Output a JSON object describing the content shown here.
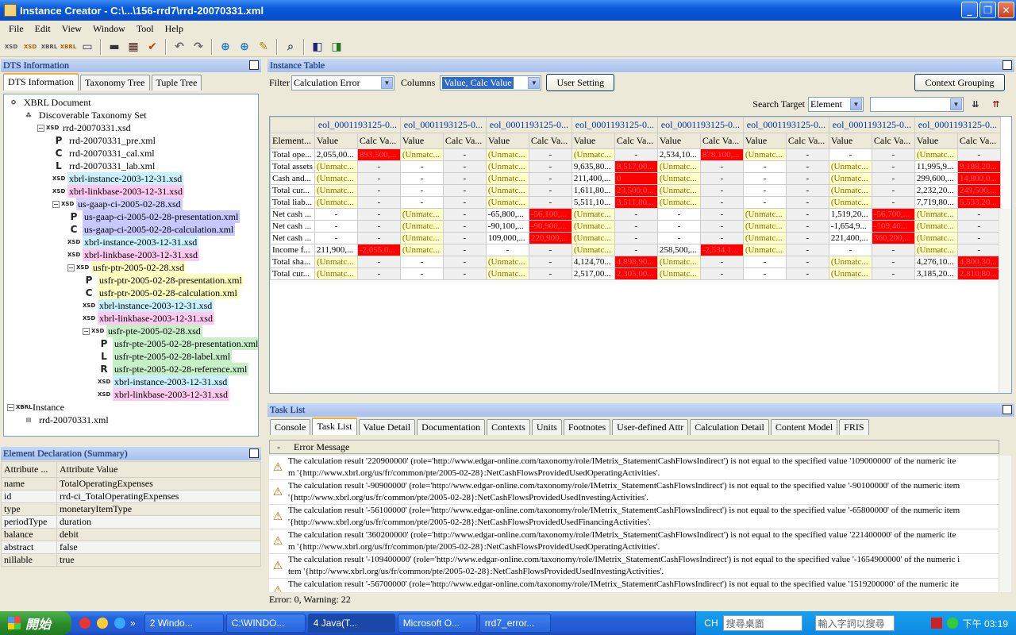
{
  "window": {
    "title": "Instance Creator - C:\\...\\156-rrd7\\rrd-20070331.xml"
  },
  "menu": [
    "File",
    "Edit",
    "View",
    "Window",
    "Tool",
    "Help"
  ],
  "toolbar_icons": [
    "xsd",
    "xsd-new",
    "xbrl",
    "xbrl-new",
    "table",
    "save",
    "print",
    "check",
    "undo",
    "redo",
    "add",
    "add2",
    "edit",
    "find",
    "back",
    "forward"
  ],
  "dts": {
    "title": "DTS Information",
    "tabs": [
      "DTS Information",
      "Taxonomy Tree",
      "Tuple Tree"
    ],
    "tree": [
      {
        "label": "XBRL Document",
        "icon": "root"
      },
      {
        "label": "Discoverable Taxonomy Set",
        "icon": "dts"
      },
      {
        "label": "rrd-20070331.xsd",
        "icon": "xsd"
      },
      {
        "label": "rrd-20070331_pre.xml",
        "icon": "P"
      },
      {
        "label": "rrd-20070331_cal.xml",
        "icon": "C"
      },
      {
        "label": "rrd-20070331_lab.xml",
        "icon": "L"
      },
      {
        "label": "xbrl-instance-2003-12-31.xsd",
        "icon": "xsd",
        "color": "#c8f0ff"
      },
      {
        "label": "xbrl-linkbase-2003-12-31.xsd",
        "icon": "xsd",
        "color": "#ffc8f0"
      },
      {
        "label": "us-gaap-ci-2005-02-28.xsd",
        "icon": "xsd",
        "color": "#d0d0ff"
      },
      {
        "label": "us-gaap-ci-2005-02-28-presentation.xml",
        "icon": "P",
        "color": "#c8c8ff"
      },
      {
        "label": "us-gaap-ci-2005-02-28-calculation.xml",
        "icon": "C",
        "color": "#c8c8ff"
      },
      {
        "label": "xbrl-instance-2003-12-31.xsd",
        "icon": "xsd",
        "color": "#c8f0ff"
      },
      {
        "label": "xbrl-linkbase-2003-12-31.xsd",
        "icon": "xsd",
        "color": "#ffc8f0"
      },
      {
        "label": "usfr-ptr-2005-02-28.xsd",
        "icon": "xsd",
        "color": "#ffffc0"
      },
      {
        "label": "usfr-ptr-2005-02-28-presentation.xml",
        "icon": "P",
        "color": "#ffffc0"
      },
      {
        "label": "usfr-ptr-2005-02-28-calculation.xml",
        "icon": "C",
        "color": "#ffffc0"
      },
      {
        "label": "xbrl-instance-2003-12-31.xsd",
        "icon": "xsd",
        "color": "#c8f0ff"
      },
      {
        "label": "xbrl-linkbase-2003-12-31.xsd",
        "icon": "xsd",
        "color": "#ffc8f0"
      },
      {
        "label": "usfr-pte-2005-02-28.xsd",
        "icon": "xsd",
        "color": "#c8f0c8"
      },
      {
        "label": "usfr-pte-2005-02-28-presentation.xml",
        "icon": "P",
        "color": "#c8f0c8"
      },
      {
        "label": "usfr-pte-2005-02-28-label.xml",
        "icon": "L",
        "color": "#c8f0c8"
      },
      {
        "label": "usfr-pte-2005-02-28-reference.xml",
        "icon": "R",
        "color": "#c8f0c8"
      },
      {
        "label": "xbrl-instance-2003-12-31.xsd",
        "icon": "xsd",
        "color": "#c8f0ff"
      },
      {
        "label": "xbrl-linkbase-2003-12-31.xsd",
        "icon": "xsd",
        "color": "#ffc8f0"
      },
      {
        "label": "Instance",
        "icon": "xbrl"
      },
      {
        "label": "rrd-20070331.xml",
        "icon": "xml"
      }
    ]
  },
  "element_decl": {
    "title": "Element Declaration (Summary)",
    "headers": [
      "Attribute ...",
      "Attribute Value"
    ],
    "rows": [
      [
        "name",
        "TotalOperatingExpenses"
      ],
      [
        "id",
        "rrd-ci_TotalOperatingExpenses"
      ],
      [
        "type",
        "monetaryItemType"
      ],
      [
        "periodType",
        "duration"
      ],
      [
        "balance",
        "debit"
      ],
      [
        "abstract",
        "false"
      ],
      [
        "nillable",
        "true"
      ]
    ]
  },
  "instance_table": {
    "title": "Instance Table",
    "filter_label": "Filter",
    "filter_value": "Calculation Error",
    "columns_label": "Columns",
    "columns_value": "Value, Calc Value",
    "user_setting": "User Setting",
    "context_grouping": "Context Grouping",
    "search_target_label": "Search Target",
    "search_target_value": "Element",
    "context_header": "eol_0001193125-0...",
    "element_header": "Element...",
    "value_header": "Value",
    "calc_header": "Calc Va...",
    "rows": [
      {
        "name": "Total ope...",
        "cells": [
          [
            "2,055,00...",
            "893,500,..."
          ],
          [
            "(Unmatc...",
            "-"
          ],
          [
            "(Unmatc...",
            "-"
          ],
          [
            "(Unmatc...",
            "-"
          ],
          [
            "2,534,10...",
            "878,100,..."
          ],
          [
            "(Unmatc...",
            "-"
          ],
          [
            "-",
            "-"
          ],
          [
            "(Unmatc...",
            "-"
          ]
        ]
      },
      {
        "name": "Total assets",
        "cells": [
          [
            "(Unmatc...",
            "-"
          ],
          [
            "-",
            "-"
          ],
          [
            "(Unmatc...",
            "-"
          ],
          [
            "9,635,80...",
            "8,517,00..."
          ],
          [
            "(Unmatc...",
            "-"
          ],
          [
            "-",
            "-"
          ],
          [
            "(Unmatc...",
            "-"
          ],
          [
            "11,995,9...",
            "9,188,20..."
          ]
        ]
      },
      {
        "name": "Cash and...",
        "cells": [
          [
            "(Unmatc...",
            "-"
          ],
          [
            "-",
            "-"
          ],
          [
            "(Unmatc...",
            "-"
          ],
          [
            "211,400,...",
            "0"
          ],
          [
            "(Unmatc...",
            "-"
          ],
          [
            "-",
            "-"
          ],
          [
            "(Unmatc...",
            "-"
          ],
          [
            "299,600,...",
            "14,800,0..."
          ]
        ]
      },
      {
        "name": "Total cur...",
        "cells": [
          [
            "(Unmatc...",
            "-"
          ],
          [
            "-",
            "-"
          ],
          [
            "(Unmatc...",
            "-"
          ],
          [
            "1,611,80...",
            "23,500,0..."
          ],
          [
            "(Unmatc...",
            "-"
          ],
          [
            "-",
            "-"
          ],
          [
            "(Unmatc...",
            "-"
          ],
          [
            "2,232,20...",
            "249,500,..."
          ]
        ]
      },
      {
        "name": "Total liab...",
        "cells": [
          [
            "(Unmatc...",
            "-"
          ],
          [
            "-",
            "-"
          ],
          [
            "(Unmatc...",
            "-"
          ],
          [
            "5,511,10...",
            "3,511,80..."
          ],
          [
            "(Unmatc...",
            "-"
          ],
          [
            "-",
            "-"
          ],
          [
            "(Unmatc...",
            "-"
          ],
          [
            "7,719,80...",
            "5,533,20..."
          ]
        ]
      },
      {
        "name": "Net cash ...",
        "cells": [
          [
            "-",
            "-"
          ],
          [
            "(Unmatc...",
            "-"
          ],
          [
            "-65,800,...",
            "-56,100,..."
          ],
          [
            "(Unmatc...",
            "-"
          ],
          [
            "-",
            "-"
          ],
          [
            "(Unmatc...",
            "-"
          ],
          [
            "1,519,20...",
            "-56,700,..."
          ],
          [
            "(Unmatc...",
            "-"
          ]
        ]
      },
      {
        "name": "Net cash ...",
        "cells": [
          [
            "-",
            "-"
          ],
          [
            "(Unmatc...",
            "-"
          ],
          [
            "-90,100,...",
            "-90,900,..."
          ],
          [
            "(Unmatc...",
            "-"
          ],
          [
            "-",
            "-"
          ],
          [
            "(Unmatc...",
            "-"
          ],
          [
            "-1,654,9...",
            "-109,40..."
          ],
          [
            "(Unmatc...",
            "-"
          ]
        ]
      },
      {
        "name": "Net cash ...",
        "cells": [
          [
            "-",
            "-"
          ],
          [
            "(Unmatc...",
            "-"
          ],
          [
            "109,000,...",
            "220,900,..."
          ],
          [
            "(Unmatc...",
            "-"
          ],
          [
            "-",
            "-"
          ],
          [
            "(Unmatc...",
            "-"
          ],
          [
            "221,400,...",
            "360,200,..."
          ],
          [
            "(Unmatc...",
            "-"
          ]
        ]
      },
      {
        "name": "Income f...",
        "cells": [
          [
            "211,900,...",
            "-2,055,0..."
          ],
          [
            "(Unmatc...",
            "-"
          ],
          [
            "-",
            "-"
          ],
          [
            "(Unmatc...",
            "-"
          ],
          [
            "258,500,...",
            "-2,534,1..."
          ],
          [
            "(Unmatc...",
            "-"
          ],
          [
            "-",
            "-"
          ],
          [
            "(Unmatc...",
            "-"
          ]
        ]
      },
      {
        "name": "Total sha...",
        "cells": [
          [
            "(Unmatc...",
            "-"
          ],
          [
            "-",
            "-"
          ],
          [
            "(Unmatc...",
            "-"
          ],
          [
            "4,124,70...",
            "4,898,90..."
          ],
          [
            "(Unmatc...",
            "-"
          ],
          [
            "-",
            "-"
          ],
          [
            "(Unmatc...",
            "-"
          ],
          [
            "4,276,10...",
            "4,800,30..."
          ]
        ]
      },
      {
        "name": "Total cur...",
        "cells": [
          [
            "(Unmatc...",
            "-"
          ],
          [
            "-",
            "-"
          ],
          [
            "(Unmatc...",
            "-"
          ],
          [
            "2,517,00...",
            "2,305,00..."
          ],
          [
            "(Unmatc...",
            "-"
          ],
          [
            "-",
            "-"
          ],
          [
            "(Unmatc...",
            "-"
          ],
          [
            "3,185,20...",
            "2,810,80..."
          ]
        ]
      }
    ]
  },
  "task_list": {
    "title": "Task List",
    "tabs": [
      "Console",
      "Task List",
      "Value Detail",
      "Documentation",
      "Contexts",
      "Units",
      "Footnotes",
      "User-defined Attr",
      "Calculation Detail",
      "Content Model",
      "FRIS"
    ],
    "header_dash": "-",
    "header": "Error Message",
    "messages": [
      [
        "The calculation result '220900000' (role='http://www.edgar-online.com/taxonomy/role/IMetrix_StatementCashFlowsIndirect') is not equal to the specified value '109000000' of the numeric ite",
        "m '{http://www.xbrl.org/us/fr/common/pte/2005-02-28}:NetCashFlowsProvidedUsedOperatingActivities'."
      ],
      [
        "The calculation result '-90900000' (role='http://www.edgar-online.com/taxonomy/role/IMetrix_StatementCashFlowsIndirect') is not equal to the specified value '-90100000' of the numeric item",
        "'{http://www.xbrl.org/us/fr/common/pte/2005-02-28}:NetCashFlowsProvidedUsedInvestingActivities'."
      ],
      [
        "The calculation result '-56100000' (role='http://www.edgar-online.com/taxonomy/role/IMetrix_StatementCashFlowsIndirect') is not equal to the specified value '-65800000' of the numeric item",
        "'{http://www.xbrl.org/us/fr/common/pte/2005-02-28}:NetCashFlowsProvidedUsedFinancingActivities'."
      ],
      [
        "The calculation result '360200000' (role='http://www.edgar-online.com/taxonomy/role/IMetrix_StatementCashFlowsIndirect') is not equal to the specified value '221400000' of the numeric ite",
        "m '{http://www.xbrl.org/us/fr/common/pte/2005-02-28}:NetCashFlowsProvidedUsedOperatingActivities'."
      ],
      [
        "The calculation result '-109400000' (role='http://www.edgar-online.com/taxonomy/role/IMetrix_StatementCashFlowsIndirect') is not equal to the specified value '-1654900000' of the numeric i",
        "tem '{http://www.xbrl.org/us/fr/common/pte/2005-02-28}:NetCashFlowsProvidedUsedInvestingActivities'."
      ],
      [
        "The calculation result '-56700000' (role='http://www.edgar-online.com/taxonomy/role/IMetrix_StatementCashFlowsIndirect') is not equal to the specified value '1519200000' of the numeric ite",
        ""
      ]
    ],
    "status": "Error: 0, Warning: 22"
  },
  "taskbar": {
    "start": "開始",
    "tasks": [
      "2 Windo...",
      "C:\\WINDO...",
      "4 Java(T...",
      "Microsoft O...",
      "rrd7_error..."
    ],
    "lang": "CH",
    "desktop_search": "搜尋桌面",
    "search_placeholder": "輸入字詞以搜尋",
    "clock": "下午 03:19"
  }
}
